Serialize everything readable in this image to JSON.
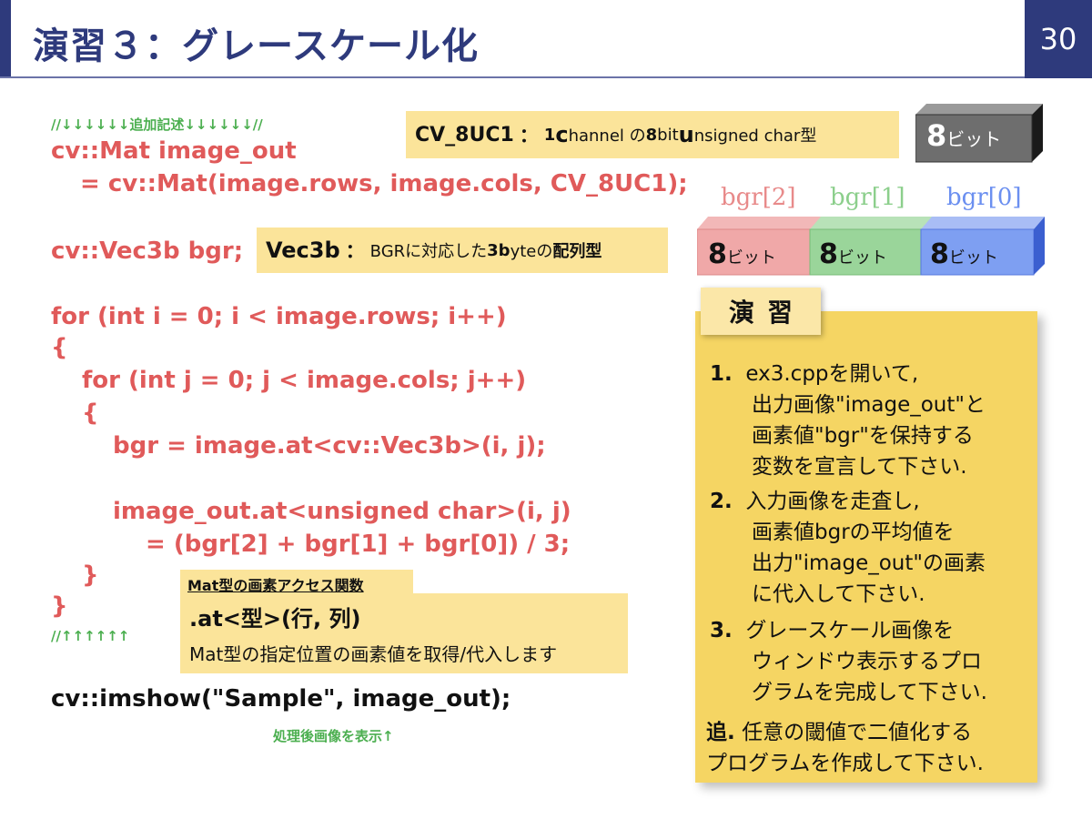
{
  "header": {
    "title": "演習３：グレースケール化",
    "page_number": "30"
  },
  "code": {
    "comment_top": "//↓↓↓↓↓↓追加記述↓↓↓↓↓↓//",
    "line1": "cv::Mat image_out",
    "line2": "= cv::Mat(image.rows, image.cols, CV_8UC1);",
    "line3": "cv::Vec3b bgr;",
    "line4": "for (int i = 0; i < image.rows; i++)",
    "line5": "{",
    "line6": "for (int j = 0; j < image.cols; j++)",
    "line7": "{",
    "line8": "bgr = image.at<cv::Vec3b>(i, j);",
    "line9": "image_out.at<unsigned char>(i, j)",
    "line10": "= (bgr[2] + bgr[1] + bgr[0]) / 3;",
    "line11": "}",
    "line12": "}",
    "comment_bottom": "//↑↑↑↑↑↑",
    "imshow": "cv::imshow(\"Sample\", image_out);",
    "imshow_note": "処理後画像を表示↑"
  },
  "notes": {
    "cv8uc1_a": "CV_8UC1",
    "cv8uc1_b": "：",
    "cv8uc1_c": "1 ",
    "cv8uc1_d": "c",
    "cv8uc1_e": "hannel の ",
    "cv8uc1_f": "8",
    "cv8uc1_g": "bit ",
    "cv8uc1_h": "u",
    "cv8uc1_i": "nsigned char型",
    "vec3b_a": "Vec3b",
    "vec3b_b": "：",
    "vec3b_c": "BGRに対応した",
    "vec3b_d": "3b",
    "vec3b_e": "yteの",
    "vec3b_f": "配列型",
    "at_header": "Mat型の画素アクセス関数",
    "at_title": ".at<型>(行, 列)",
    "at_desc": "Mat型の指定位置の画素値を取得/代入します"
  },
  "bits": {
    "single_num": "8",
    "single_unit": "ビット",
    "labels": [
      "bgr[2]",
      "bgr[1]",
      "bgr[0]"
    ],
    "cells": [
      {
        "num": "8",
        "unit": "ビット"
      },
      {
        "num": "8",
        "unit": "ビット"
      },
      {
        "num": "8",
        "unit": "ビット"
      }
    ],
    "colors": {
      "red": "#e88a8a",
      "green": "#8ccf8c",
      "blue": "#6b8ff0"
    }
  },
  "exercise": {
    "tab": "演習",
    "items": [
      {
        "num": "1.",
        "lines": [
          "ex3.cppを開いて,",
          "出力画像\"image_out\"と",
          "画素値\"bgr\"を保持する",
          "変数を宣言して下さい."
        ]
      },
      {
        "num": "2.",
        "lines": [
          "入力画像を走査し,",
          "画素値bgrの平均値を",
          "出力\"image_out\"の画素",
          "に代入して下さい."
        ]
      },
      {
        "num": "3.",
        "lines": [
          "グレースケール画像を",
          "ウィンドウ表示するプロ",
          "グラムを完成して下さい."
        ]
      }
    ],
    "extra_num": "追.",
    "extra_lines": [
      "任意の閾値で二値化する",
      "プログラムを作成して下さい."
    ]
  }
}
